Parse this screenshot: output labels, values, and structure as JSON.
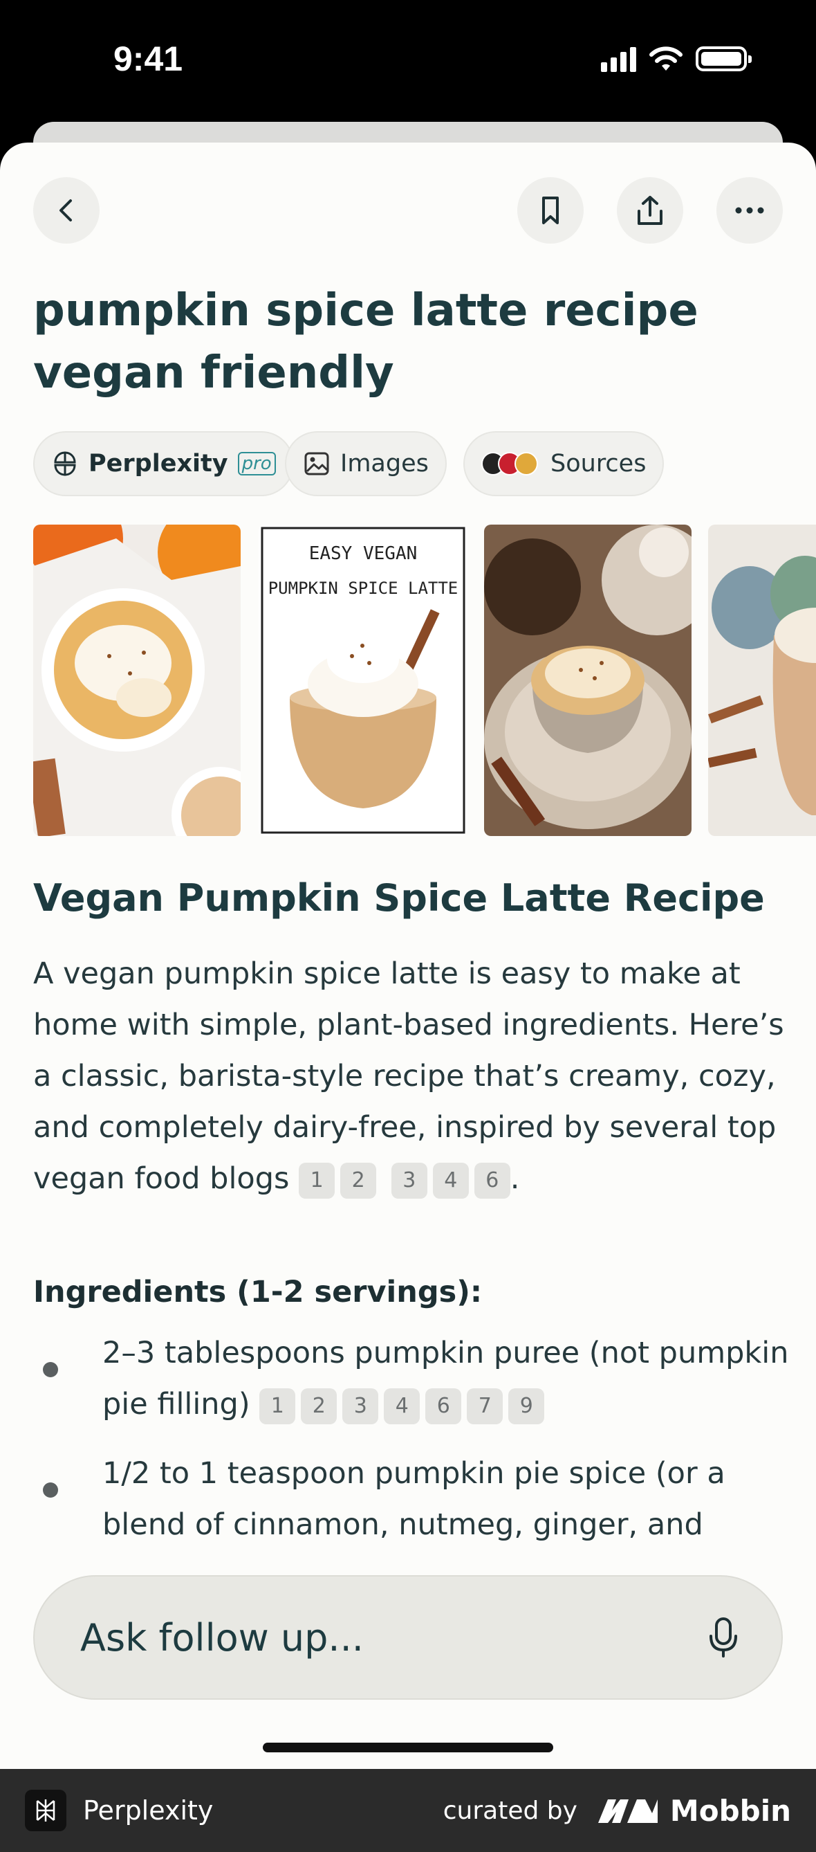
{
  "status_bar": {
    "time": "9:41"
  },
  "query": {
    "title": "pumpkin spice latte recipe vegan friendly"
  },
  "chips": {
    "perplexity": "Perplexity",
    "pro": "pro",
    "images": "Images",
    "sources": "Sources"
  },
  "images": [
    {
      "name": "latte-mug-with-foam",
      "caption": ""
    },
    {
      "name": "easy-vegan-psl-poster",
      "caption": "EASY VEGAN PUMPKIN SPICE LATTE"
    },
    {
      "name": "latte-cup-on-saucer",
      "caption": ""
    },
    {
      "name": "latte-glass-with-pumpkins",
      "caption": ""
    }
  ],
  "answer": {
    "heading": "Vegan Pumpkin Spice Latte Recipe",
    "intro": "A vegan pumpkin spice latte is easy to make at home with simple, plant-based ingredients. Here’s a classic, barista-style recipe that’s creamy, cozy, and completely dairy-free, inspired by several top vegan food blogs",
    "intro_citations": [
      "1",
      "2",
      "3",
      "4",
      "6"
    ],
    "intro_end": ".",
    "ingredients_heading": "Ingredients (1-2 servings):",
    "ingredients": [
      {
        "text": "2–3 tablespoons pumpkin puree (not pumpkin pie filling)",
        "citations": [
          "1",
          "2",
          "3",
          "4",
          "6",
          "7",
          "9"
        ]
      },
      {
        "text": "1/2 to 1 teaspoon pumpkin pie spice (or a blend of cinnamon, nutmeg, ginger, and",
        "citations": []
      }
    ]
  },
  "follow_up": {
    "placeholder": "Ask follow up..."
  },
  "footer": {
    "app_name": "Perplexity",
    "curated_by": "curated by",
    "brand": "Mobbin"
  },
  "colors": {
    "accent": "#2e8f95",
    "title": "#1d3b40",
    "background": "#fcfcfa"
  }
}
